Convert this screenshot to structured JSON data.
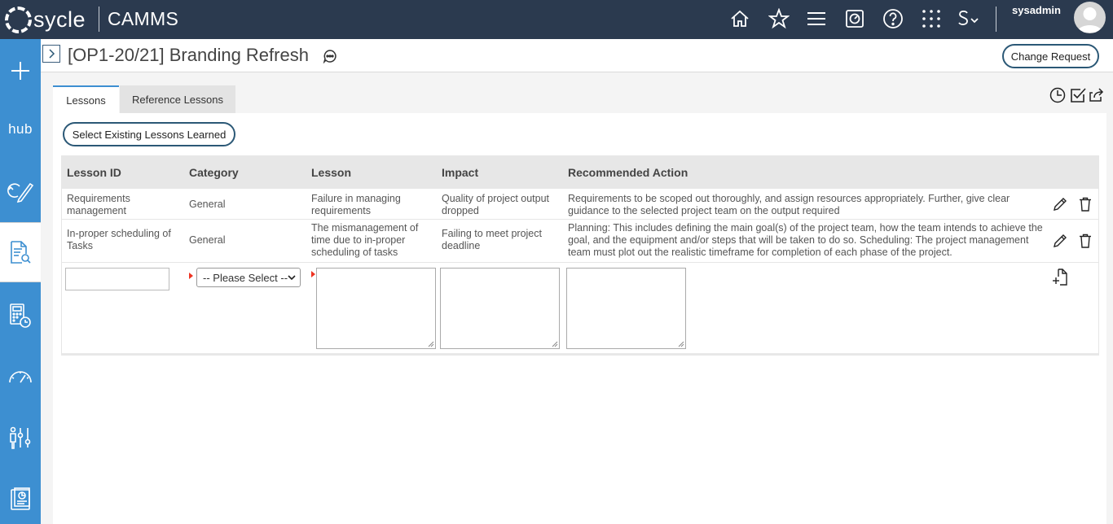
{
  "topbar": {
    "logo_text": "sycle",
    "app_name": "CAMMS",
    "username": "sysadmin",
    "icons": [
      "home-icon",
      "star-icon",
      "menu-icon",
      "gauge-icon",
      "help-icon",
      "apps-grid-icon",
      "switch-user-icon"
    ]
  },
  "sidebar": {
    "items": [
      {
        "icon": "plus-icon"
      },
      {
        "icon": "hub-icon",
        "label": "hub"
      },
      {
        "icon": "cycle-edit-icon"
      },
      {
        "icon": "document-search-icon",
        "active": true
      },
      {
        "icon": "calculator-clock-icon"
      },
      {
        "icon": "speedometer-icon"
      },
      {
        "icon": "resources-icon"
      },
      {
        "icon": "report-icon"
      }
    ]
  },
  "header": {
    "title": "[OP1-20/21] Branding Refresh",
    "change_request_label": "Change Request"
  },
  "tabs": [
    {
      "label": "Lessons",
      "active": true
    },
    {
      "label": "Reference Lessons",
      "active": false
    }
  ],
  "toolbar_icons": [
    "history-icon",
    "checkbox-icon",
    "share-icon"
  ],
  "select_existing_label": "Select Existing Lessons Learned",
  "table": {
    "columns": [
      "Lesson ID",
      "Category",
      "Lesson",
      "Impact",
      "Recommended Action"
    ],
    "rows": [
      {
        "lesson_id": "Requirements management",
        "category": "General",
        "lesson": "Failure in managing requirements",
        "impact": "Quality of project output dropped",
        "action": "Requirements to be scoped out thoroughly, and assign resources appropriately. Further, give clear guidance to the selected project team on the output required"
      },
      {
        "lesson_id": "In-proper scheduling of Tasks",
        "category": "General",
        "lesson": "The mismanagement of time due to in-proper scheduling of tasks",
        "impact": "Failing to meet project deadline",
        "action": "Planning: This includes defining the main goal(s) of the project team, how the team intends to achieve the goal, and the equipment and/or steps that will be taken to do so. Scheduling: The project management team must plot out the realistic timeframe for completion of each phase of the project."
      }
    ],
    "new_row": {
      "category_placeholder": "-- Please Select --"
    }
  },
  "colors": {
    "topbar": "#2b3a4f",
    "sidebar": "#3d8fd1",
    "button_border": "#2b5876",
    "required_marker": "#e33322"
  }
}
